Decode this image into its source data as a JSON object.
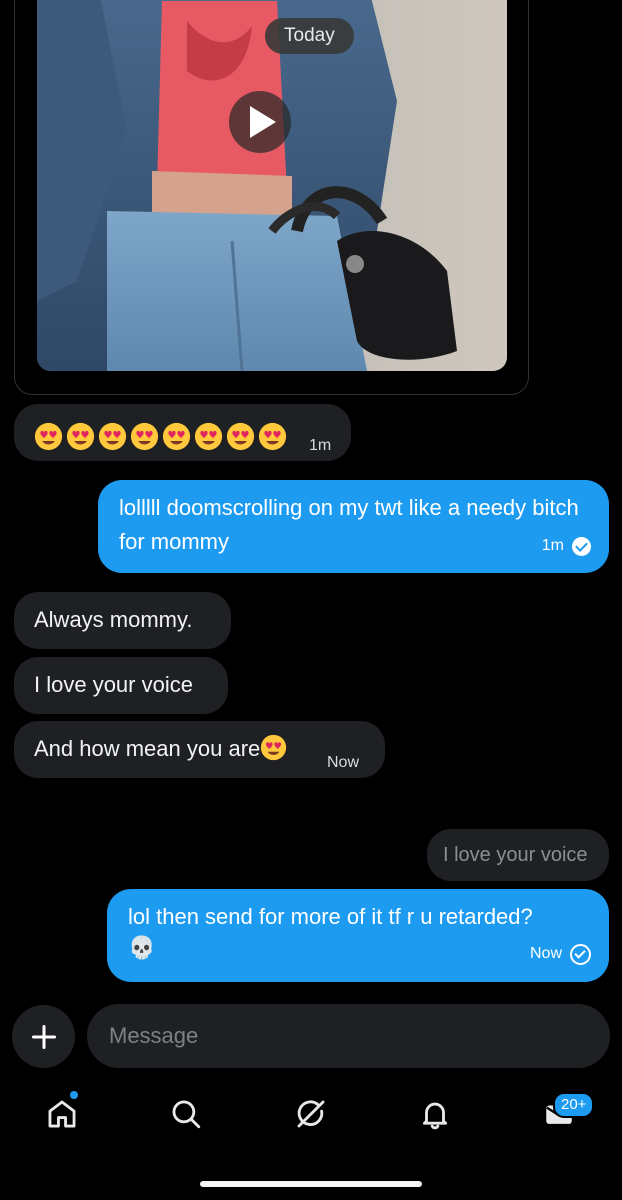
{
  "conversation": {
    "date_separator": "Today",
    "messages": [
      {
        "id": "emoji-reaction",
        "direction": "in",
        "emoji": "heart-eyes",
        "emoji_count": 8,
        "time": "1m"
      },
      {
        "id": "out-1",
        "direction": "out",
        "text": "lolllll doomscrolling on my twt like a needy bitch for mommy",
        "time": "1m",
        "status": "read"
      },
      {
        "id": "in-1",
        "direction": "in",
        "text": "Always mommy."
      },
      {
        "id": "in-2",
        "direction": "in",
        "text": "I love your voice"
      },
      {
        "id": "in-3",
        "direction": "in",
        "text": "And how mean you are",
        "trailing_emoji": "heart-eyes",
        "time": "Now"
      },
      {
        "id": "reply-preview",
        "direction": "out",
        "text": "I love your voice"
      },
      {
        "id": "out-2",
        "direction": "out",
        "text": "lol then send for more of it tf r u retarded?",
        "trailing_emoji": "💀",
        "time": "Now",
        "status": "sent"
      }
    ]
  },
  "media": {
    "type": "video",
    "icon": "play-icon"
  },
  "composer": {
    "add_icon": "plus-icon",
    "placeholder": "Message"
  },
  "nav": {
    "items": [
      {
        "name": "home",
        "icon": "home-icon",
        "indicator": true
      },
      {
        "name": "search",
        "icon": "search-icon"
      },
      {
        "name": "grok",
        "icon": "grok-icon"
      },
      {
        "name": "notifications",
        "icon": "bell-icon"
      },
      {
        "name": "messages",
        "icon": "envelope-icon",
        "badge": "20+"
      }
    ]
  },
  "colors": {
    "background": "#000000",
    "incoming_bubble": "#1e2023",
    "outgoing_bubble": "#1d9bf0",
    "accent": "#1d9bf0"
  }
}
